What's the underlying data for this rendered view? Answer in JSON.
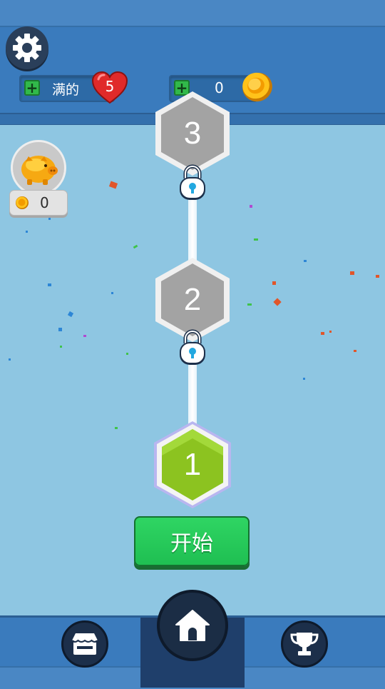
{
  "header": {
    "lives_label": "满的",
    "lives_count": "5",
    "coins_count": "0"
  },
  "piggy_bank": {
    "amount": "0"
  },
  "levels": [
    {
      "number": "1",
      "state": "current"
    },
    {
      "number": "2",
      "state": "locked"
    },
    {
      "number": "3",
      "state": "locked"
    }
  ],
  "start_button": {
    "label": "开始"
  },
  "bottom_nav": {
    "items": [
      {
        "icon": "shop-icon"
      },
      {
        "icon": "home-icon",
        "active": true
      },
      {
        "icon": "trophy-icon"
      }
    ]
  },
  "colors": {
    "background": "#8ec6e2",
    "header": "#3a7bbd",
    "level_locked": "#a3a3a3",
    "level_current": "#8cc320",
    "start_button": "#25c957",
    "plus_button": "#31b94a"
  },
  "icons": {
    "settings": "gear-icon",
    "heart": "heart-icon",
    "coin": "coin-icon",
    "piggy": "piggy-bank-icon",
    "lock": "lock-icon"
  }
}
